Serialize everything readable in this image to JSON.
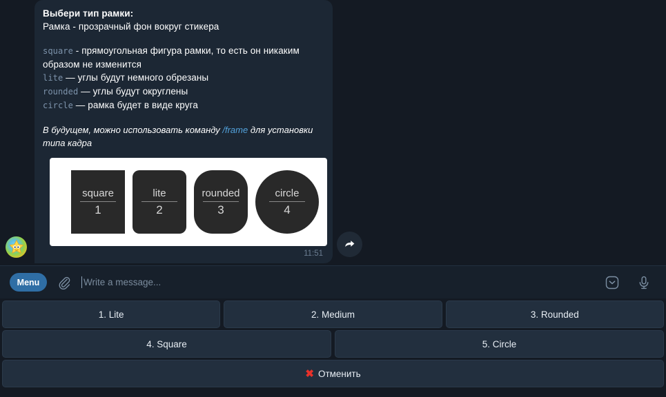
{
  "message": {
    "title": "Выбери тип рамки:",
    "subtitle": "Рамка - прозрачный фон вокруг стикера",
    "definitions": [
      {
        "code": "square",
        "text": " - прямоугольная фигура рамки, то есть он никаким образом не изменится"
      },
      {
        "code": "lite",
        "text": " — углы будут немного обрезаны"
      },
      {
        "code": "rounded",
        "text": " — углы будут округлены"
      },
      {
        "code": "circle",
        "text": " — рамка будет в виде круга"
      }
    ],
    "note_before": "В будущем, можно использовать команду ",
    "note_link": "/frame",
    "note_after": " для установки типа кадра",
    "timestamp": "11:51",
    "forward_icon": "forward-arrow-icon",
    "avatar_icon": "star-character-avatar"
  },
  "media": {
    "tiles": [
      {
        "name": "square",
        "number": "1",
        "shape": "square"
      },
      {
        "name": "lite",
        "number": "2",
        "shape": "lite"
      },
      {
        "name": "rounded",
        "number": "3",
        "shape": "rounded"
      },
      {
        "name": "circle",
        "number": "4",
        "shape": "circle"
      }
    ],
    "accent_color": "#3a8fd9",
    "card_background": "#ffffff",
    "tile_background": "#292929"
  },
  "composer": {
    "menu_label": "Menu",
    "menu_color": "#2f6ea5",
    "attach_icon": "paperclip-icon",
    "placeholder": "Write a message...",
    "input_value": "",
    "sticker_icon": "chevron-down-square-icon",
    "voice_icon": "microphone-icon"
  },
  "keyboard": {
    "rows": [
      [
        {
          "label": "1. Lite"
        },
        {
          "label": "2. Medium"
        },
        {
          "label": "3. Rounded"
        }
      ],
      [
        {
          "label": "4. Square"
        },
        {
          "label": "5. Circle"
        }
      ]
    ],
    "cancel": {
      "icon": "cross-mark-emoji",
      "glyph": "✖",
      "label": "Отменить"
    }
  },
  "colors": {
    "page_background": "#141a23",
    "bubble_background": "#1c2734",
    "composer_background": "#17202b",
    "keyboard_button": "#222f3e",
    "link": "#53a3dd",
    "code_text": "#7d93ab",
    "timestamp_text": "#6b7d91",
    "cancel_red": "#e8312a"
  }
}
